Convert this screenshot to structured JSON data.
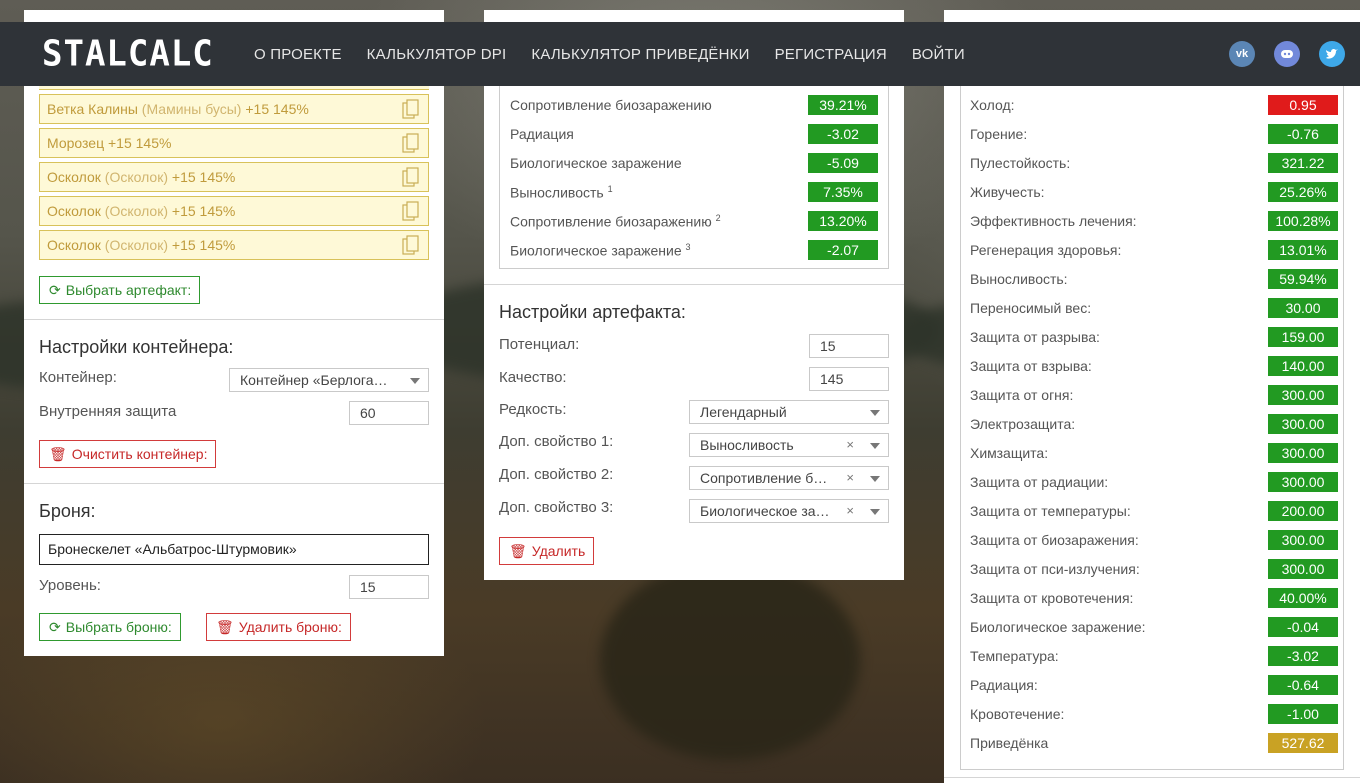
{
  "brand": {
    "logo": "STALCALC"
  },
  "nav": {
    "items": [
      "О ПРОЕКТЕ",
      "КАЛЬКУЛЯТОР DPI",
      "КАЛЬКУЛЯТОР ПРИВЕДЁНКИ",
      "РЕГИСТРАЦИЯ",
      "ВОЙТИ"
    ]
  },
  "social": {
    "vk": "vk-icon",
    "discord": "discord-icon",
    "twitter": "twitter-icon",
    "vk_color": "#5b86b5",
    "discord_color": "#7289da",
    "twitter_color": "#3ea8e8"
  },
  "container": {
    "artifacts": [
      {
        "name": "Ветка Калины",
        "alias": "(Мамины бусы)",
        "stats": "+15 145%"
      },
      {
        "name": "Морозец",
        "alias": "",
        "stats": "+15 145%"
      },
      {
        "name": "Осколок",
        "alias": "(Осколок)",
        "stats": "+15 145%"
      },
      {
        "name": "Осколок",
        "alias": "(Осколок)",
        "stats": "+15 145%"
      },
      {
        "name": "Осколок",
        "alias": "(Осколок)",
        "stats": "+15 145%"
      }
    ],
    "choose_artifact_label": "Выбрать артефакт:",
    "settings_title": "Настройки контейнера:",
    "container_label": "Контейнер:",
    "container_value": "Контейнер «Берлога…",
    "inner_protection_label": "Внутренняя защита",
    "inner_protection_value": "60",
    "clear_label": "Очистить контейнер:"
  },
  "armor": {
    "title": "Броня:",
    "name": "Бронескелет «Альбатрос-Штурмовик»",
    "level_label": "Уровень:",
    "level_value": "15",
    "choose_label": "Выбрать броню:",
    "delete_label": "Удалить броню:"
  },
  "artifact_stats": [
    {
      "label": "Сопротивление биозаражению",
      "sup": "",
      "value": "39.21%",
      "color": "green"
    },
    {
      "label": "Радиация",
      "sup": "",
      "value": "-3.02",
      "color": "green"
    },
    {
      "label": "Биологическое заражение",
      "sup": "",
      "value": "-5.09",
      "color": "green"
    },
    {
      "label": "Выносливость",
      "sup": "1",
      "value": "7.35%",
      "color": "green"
    },
    {
      "label": "Сопротивление биозаражению",
      "sup": "2",
      "value": "13.20%",
      "color": "green"
    },
    {
      "label": "Биологическое заражение",
      "sup": "3",
      "value": "-2.07",
      "color": "green"
    }
  ],
  "artifact_settings": {
    "title": "Настройки артефакта:",
    "potential_label": "Потенциал:",
    "potential_value": "15",
    "quality_label": "Качество:",
    "quality_value": "145",
    "rarity_label": "Редкость:",
    "rarity_value": "Легендарный",
    "extra1_label": "Доп. свойство 1:",
    "extra1_value": "Выносливость",
    "extra2_label": "Доп. свойство 2:",
    "extra2_value": "Сопротивление б…",
    "extra3_label": "Доп. свойство 3:",
    "extra3_value": "Биологическое за…",
    "delete_label": "Удалить"
  },
  "totals": [
    {
      "label": "Холод:",
      "value": "0.95",
      "color": "red"
    },
    {
      "label": "Горение:",
      "value": "-0.76",
      "color": "green"
    },
    {
      "label": "Пулестойкость:",
      "value": "321.22",
      "color": "green"
    },
    {
      "label": "Живучесть:",
      "value": "25.26%",
      "color": "green"
    },
    {
      "label": "Эффективность лечения:",
      "value": "100.28%",
      "color": "green"
    },
    {
      "label": "Регенерация здоровья:",
      "value": "13.01%",
      "color": "green"
    },
    {
      "label": "Выносливость:",
      "value": "59.94%",
      "color": "green"
    },
    {
      "label": "Переносимый вес:",
      "value": "30.00",
      "color": "green"
    },
    {
      "label": "Защита от разрыва:",
      "value": "159.00",
      "color": "green"
    },
    {
      "label": "Защита от взрыва:",
      "value": "140.00",
      "color": "green"
    },
    {
      "label": "Защита от огня:",
      "value": "300.00",
      "color": "green"
    },
    {
      "label": "Электрозащита:",
      "value": "300.00",
      "color": "green"
    },
    {
      "label": "Химзащита:",
      "value": "300.00",
      "color": "green"
    },
    {
      "label": "Защита от радиации:",
      "value": "300.00",
      "color": "green"
    },
    {
      "label": "Защита от температуры:",
      "value": "200.00",
      "color": "green"
    },
    {
      "label": "Защита от биозаражения:",
      "value": "300.00",
      "color": "green"
    },
    {
      "label": "Защита от пси-излучения:",
      "value": "300.00",
      "color": "green"
    },
    {
      "label": "Защита от кровотечения:",
      "value": "40.00%",
      "color": "green"
    },
    {
      "label": "Биологическое заражение:",
      "value": "-0.04",
      "color": "green"
    },
    {
      "label": "Температура:",
      "value": "-3.02",
      "color": "green"
    },
    {
      "label": "Радиация:",
      "value": "-0.64",
      "color": "green"
    },
    {
      "label": "Кровотечение:",
      "value": "-1.00",
      "color": "green"
    },
    {
      "label": "Приведёнка",
      "value": "527.62",
      "color": "gold"
    }
  ]
}
